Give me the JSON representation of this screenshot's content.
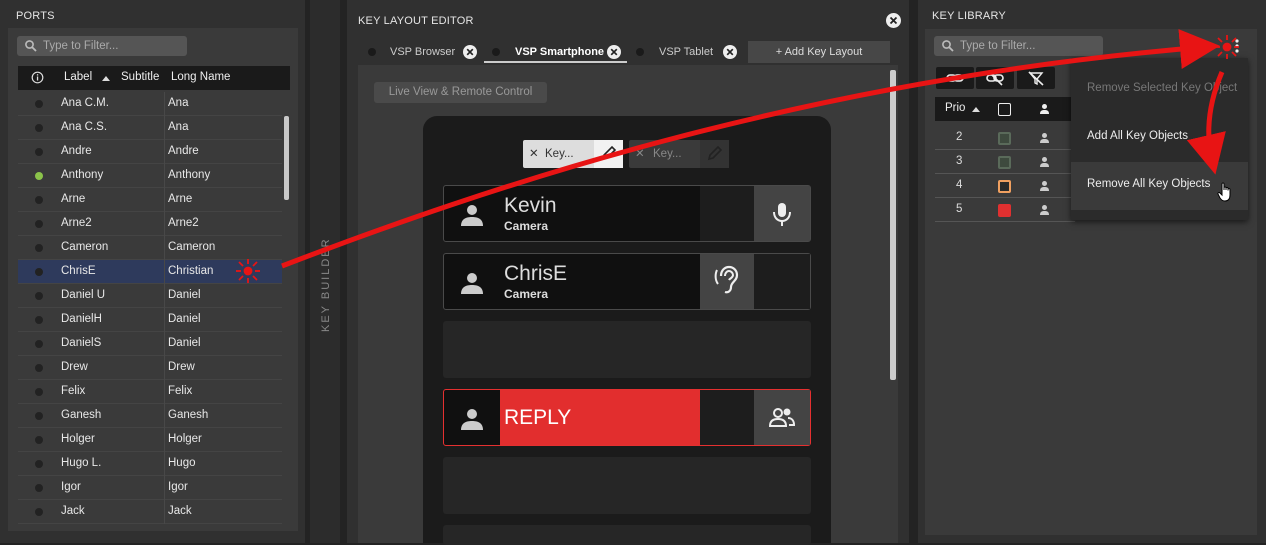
{
  "ports": {
    "title": "PORTS",
    "filter_placeholder": "Type to Filter...",
    "columns": [
      "Label",
      "Subtitle",
      "Long Name"
    ],
    "rows": [
      {
        "label": "Ana C.M.",
        "long": "Ana",
        "status": "off"
      },
      {
        "label": "Ana C.S.",
        "long": "Ana",
        "status": "off"
      },
      {
        "label": "Andre",
        "long": "Andre",
        "status": "off"
      },
      {
        "label": "Anthony",
        "long": "Anthony",
        "status": "online"
      },
      {
        "label": "Arne",
        "long": "Arne",
        "status": "off"
      },
      {
        "label": "Arne2",
        "long": "Arne2",
        "status": "off"
      },
      {
        "label": "Cameron",
        "long": "Cameron",
        "status": "off"
      },
      {
        "label": "ChrisE",
        "long": "Christian",
        "status": "off",
        "selected": true
      },
      {
        "label": "Daniel U",
        "long": "Daniel",
        "status": "off"
      },
      {
        "label": "DanielH",
        "long": "Daniel",
        "status": "off"
      },
      {
        "label": "DanielS",
        "long": "Daniel",
        "status": "off"
      },
      {
        "label": "Drew",
        "long": "Drew",
        "status": "off"
      },
      {
        "label": "Felix",
        "long": "Felix",
        "status": "off"
      },
      {
        "label": "Ganesh",
        "long": "Ganesh",
        "status": "off"
      },
      {
        "label": "Holger",
        "long": "Holger",
        "status": "off"
      },
      {
        "label": "Hugo L.",
        "long": "Hugo",
        "status": "off"
      },
      {
        "label": "Igor",
        "long": "Igor",
        "status": "off"
      },
      {
        "label": "Jack",
        "long": "Jack",
        "status": "off"
      }
    ]
  },
  "builder": {
    "vertical_label": "KEY BUILDER"
  },
  "editor": {
    "title": "KEY LAYOUT EDITOR",
    "tabs": [
      "VSP Browser",
      "VSP Smartphone",
      "VSP Tablet"
    ],
    "active_tab": "VSP Smartphone",
    "add_layout": "+ Add Key Layout",
    "live_view": "Live View & Remote Control",
    "chips": [
      "Key...",
      "Key..."
    ],
    "keys": [
      {
        "name": "Kevin",
        "sub": "Camera",
        "icon": "microphone-icon"
      },
      {
        "name": "ChrisE",
        "sub": "Camera",
        "icon": "ear-icon"
      },
      {
        "name": "",
        "sub": ""
      },
      {
        "name": "REPLY",
        "sub": "",
        "icon": "group-icon"
      },
      {
        "name": "",
        "sub": ""
      }
    ]
  },
  "library": {
    "title": "KEY LIBRARY",
    "filter_placeholder": "Type to Filter...",
    "column_prio": "Prio",
    "rows": [
      {
        "prio": "2",
        "color": "#3e4a3e",
        "border": "#5a6a5a"
      },
      {
        "prio": "3",
        "color": "#3e4a3e",
        "border": "#5a6a5a"
      },
      {
        "prio": "4",
        "color": "#2a2a2a",
        "border": "#f0a060"
      },
      {
        "prio": "5",
        "color": "#e03030",
        "border": "#e03030"
      }
    ],
    "menu": {
      "remove_selected": "Remove Selected Key Object",
      "add_all": "Add All Key Objects",
      "remove_all": "Remove All Key Objects"
    }
  },
  "colors": {
    "accent_red": "#e22e2e",
    "online_green": "#8bc34a",
    "selection": "#2e3a5c"
  }
}
